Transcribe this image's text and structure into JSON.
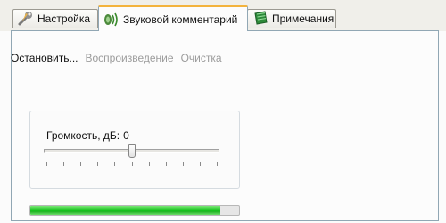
{
  "tabs": [
    {
      "label": "Настройка",
      "icon": "wrench-icon",
      "active": false
    },
    {
      "label": "Звуковой комментарий",
      "icon": "speaker-icon",
      "active": true
    },
    {
      "label": "Примечания",
      "icon": "notebook-icon",
      "active": false
    }
  ],
  "toolbar": {
    "stop_label": "Остановить...",
    "play_label": "Воспроизведение",
    "clear_label": "Очистка"
  },
  "volume": {
    "label": "Громкость, дБ:",
    "value": "0",
    "level_fraction": 0.5,
    "tick_count": 11
  },
  "progress": {
    "fraction": 0.91,
    "color": "#15c21b"
  },
  "colors": {
    "active_tab_accent": "#f3b33d",
    "panel_border": "#91a7b4",
    "disabled_text": "#9c9c9c"
  }
}
